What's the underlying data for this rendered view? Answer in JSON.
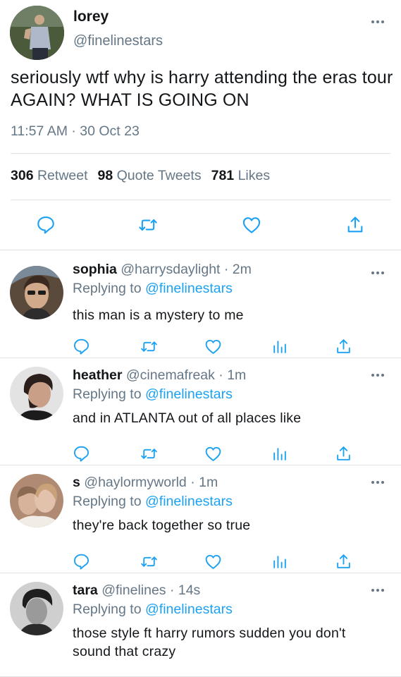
{
  "tweet": {
    "display_name": "lorey",
    "handle": "@finelinestars",
    "text": "seriously wtf why is harry attending the eras tour AGAIN? WHAT IS GOING ON",
    "timestamp": "11:57 AM · 30 Oct 23",
    "stats": {
      "retweets_count": "306",
      "retweets_label": "Retweet",
      "quotes_count": "98",
      "quotes_label": "Quote Tweets",
      "likes_count": "781",
      "likes_label": "Likes"
    },
    "actions": [
      "reply-icon",
      "retweet-icon",
      "like-icon",
      "share-icon"
    ]
  },
  "replies": [
    {
      "display_name": "sophia",
      "handle": "@harrysdaylight · 2m",
      "replying_prefix": "Replying to",
      "replying_to": "@finelinestars",
      "text": "this man is a mystery to me"
    },
    {
      "display_name": "heather",
      "handle": "@cinemafreak · 1m",
      "replying_prefix": "Replying to",
      "replying_to": "@finelinestars",
      "text": "and in ATLANTA out of all places like"
    },
    {
      "display_name": "s",
      "handle": "@haylormyworld · 1m",
      "replying_prefix": "Replying to",
      "replying_to": "@finelinestars",
      "text": "they're back together so true"
    },
    {
      "display_name": "tara",
      "handle": "@finelines · 14s",
      "replying_prefix": "Replying to",
      "replying_to": "@finelinestars",
      "text": "those style ft harry rumors sudden you don't sound that crazy"
    }
  ],
  "reply_actions": [
    "reply-icon",
    "retweet-icon",
    "like-icon",
    "analytics-icon",
    "share-icon"
  ],
  "colors": {
    "link": "#1da1f2",
    "secondary_text": "#657786",
    "divider": "#dfe3e7",
    "primary_text": "#14171a"
  }
}
